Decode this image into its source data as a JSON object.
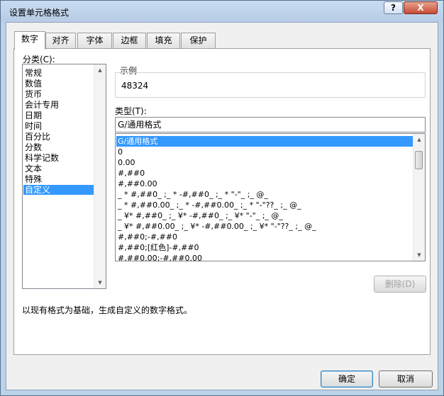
{
  "window": {
    "title": "设置单元格格式",
    "help_label": "?",
    "close_label": "X"
  },
  "tabs": [
    {
      "label": "数字",
      "active": true
    },
    {
      "label": "对齐"
    },
    {
      "label": "字体"
    },
    {
      "label": "边框"
    },
    {
      "label": "填充"
    },
    {
      "label": "保护"
    }
  ],
  "category": {
    "label": "分类(C):",
    "items": [
      "常规",
      "数值",
      "货币",
      "会计专用",
      "日期",
      "时间",
      "百分比",
      "分数",
      "科学记数",
      "文本",
      "特殊",
      "自定义"
    ],
    "selected": "自定义"
  },
  "sample": {
    "label": "示例",
    "value": "48324"
  },
  "type": {
    "label": "类型(T):",
    "input_value": "G/通用格式",
    "items": [
      "G/通用格式",
      "0",
      "0.00",
      "#,##0",
      "#,##0.00",
      "_ * #,##0_ ;_ * -#,##0_ ;_ * \"-\"_ ;_ @_",
      "_ * #,##0.00_ ;_ * -#,##0.00_ ;_ * \"-\"??_ ;_ @_",
      "_ ¥* #,##0_ ;_ ¥* -#,##0_ ;_ ¥* \"-\"_ ;_ @_",
      "_ ¥* #,##0.00_ ;_ ¥* -#,##0.00_ ;_ ¥* \"-\"??_ ;_ @_",
      "#,##0;-#,##0",
      "#,##0;[红色]-#,##0",
      "#,##0.00;-#,##0.00"
    ],
    "selected": "G/通用格式"
  },
  "delete_button": "删除(D)",
  "description": "以现有格式为基础，生成自定义的数字格式。",
  "ok_button": "确定",
  "cancel_button": "取消",
  "colors": {
    "selection": "#3399ff",
    "window_frame": "#bcd2e8",
    "close_button": "#c64b34"
  }
}
